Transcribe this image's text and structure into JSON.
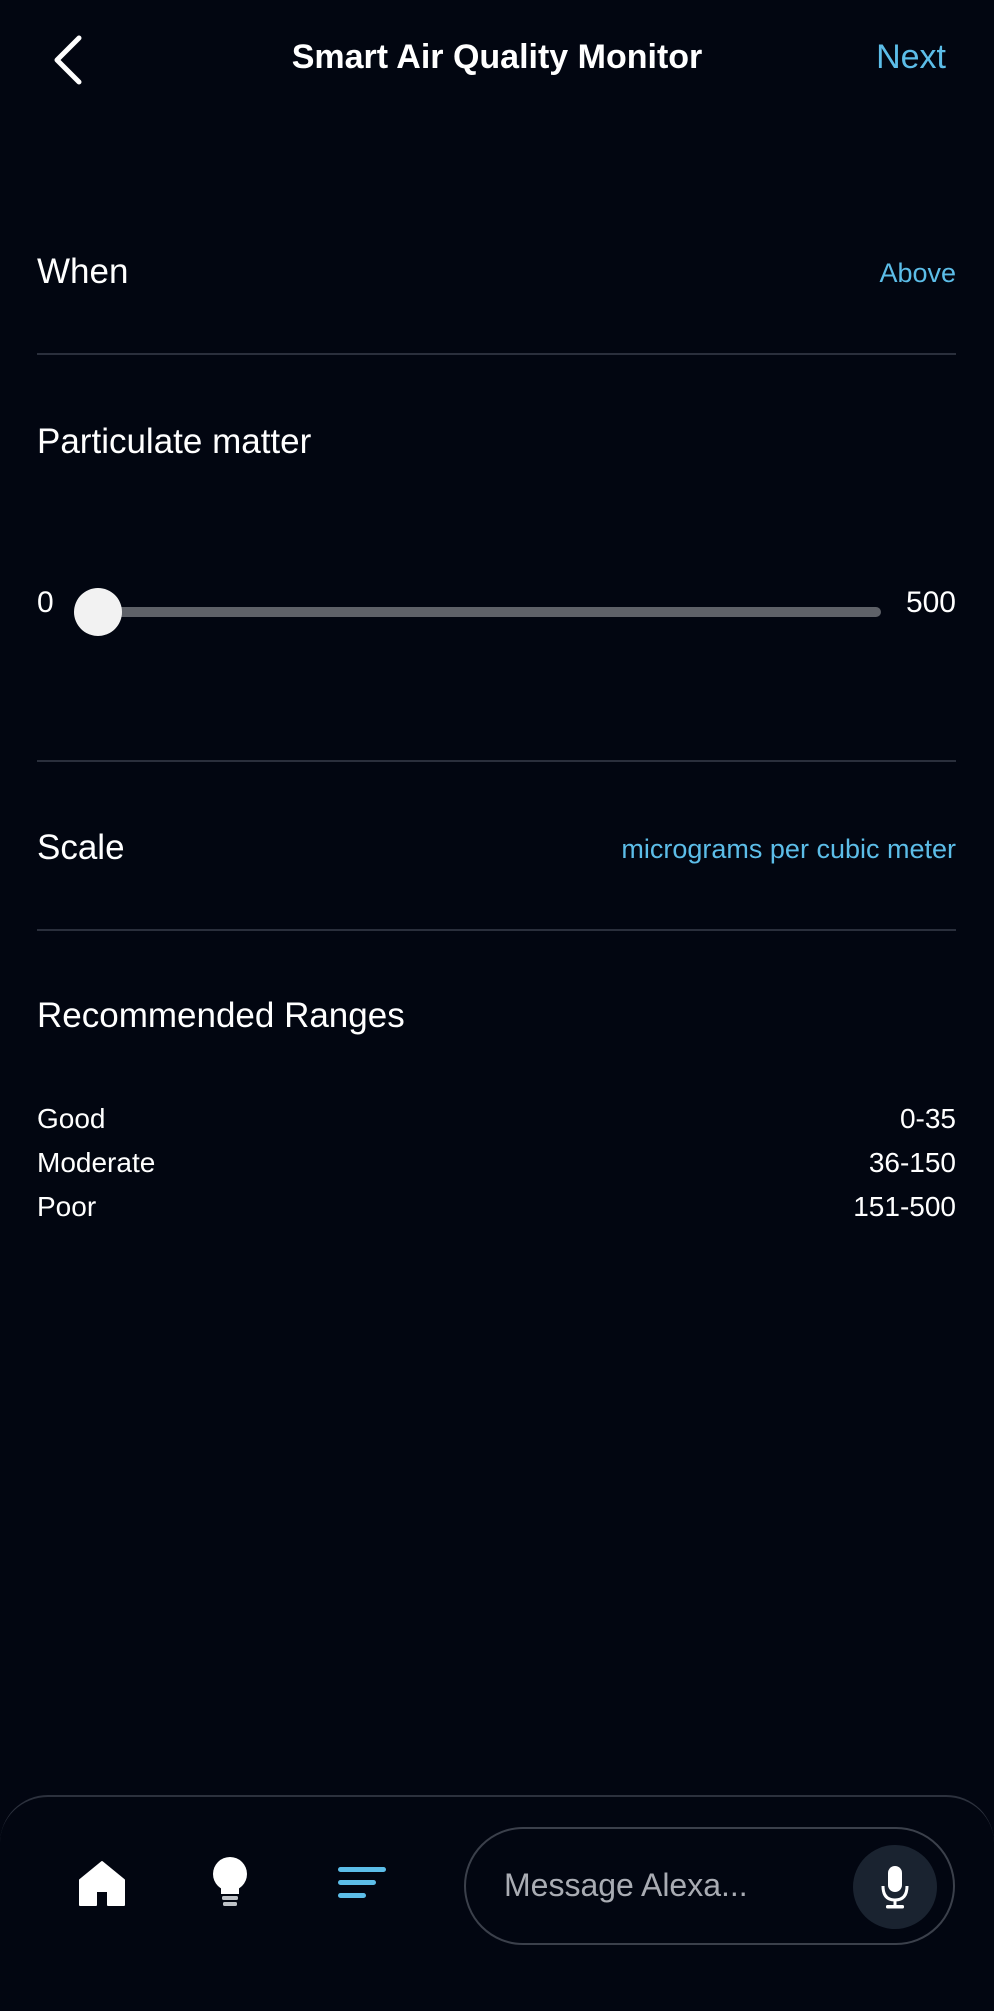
{
  "header": {
    "back_icon": "chevron-left-icon",
    "title": "Smart Air Quality Monitor",
    "next_label": "Next"
  },
  "when": {
    "label": "When",
    "value": "Above"
  },
  "particulate": {
    "label": "Particulate matter",
    "slider_min": "0",
    "slider_max": "500",
    "slider_value": 0
  },
  "scale": {
    "label": "Scale",
    "value": "micrograms per cubic meter"
  },
  "recommended": {
    "title": "Recommended Ranges",
    "items": [
      {
        "name": "Good",
        "range": "0-35"
      },
      {
        "name": "Moderate",
        "range": "36-150"
      },
      {
        "name": "Poor",
        "range": "151-500"
      }
    ]
  },
  "bottom_nav": {
    "home_icon": "home-icon",
    "devices_icon": "lightbulb-icon",
    "more_icon": "menu-lines-icon",
    "message_placeholder": "Message Alexa...",
    "mic_icon": "microphone-icon"
  },
  "colors": {
    "background": "#020611",
    "accent": "#5cbde8",
    "divider": "#2a2f3c"
  }
}
